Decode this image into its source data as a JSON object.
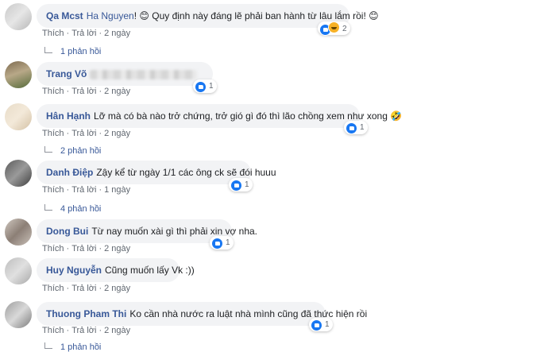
{
  "actions": {
    "like": "Thích",
    "reply": "Trả lời",
    "dot": "·"
  },
  "comments": [
    {
      "author": "Qa Mcst",
      "mention": "Ha Nguyen",
      "text": "! 😊 Quy định này đáng lẽ phải ban hành từ lâu lắm rồi! 😊",
      "time": "2 ngày",
      "reactions": {
        "types": [
          "like-icon",
          "haha-icon"
        ],
        "count": "2"
      },
      "replies": "1 phản hồi"
    },
    {
      "author": "Trang Võ",
      "text": "",
      "time": "2 ngày",
      "reactions": {
        "types": [
          "like-icon"
        ],
        "count": "1"
      },
      "replies": ""
    },
    {
      "author": "Hân Hạnh",
      "text": "Lỡ mà có bà nào trở chứng, trở gió gì đó thì lão chồng xem như xong 🤣",
      "time": "2 ngày",
      "reactions": {
        "types": [
          "like-icon"
        ],
        "count": "1"
      },
      "replies": "2 phản hồi"
    },
    {
      "author": "Danh Điệp",
      "text": "Zậy kể từ ngày 1/1 các ông ck sẽ đói huuu",
      "time": "1 ngày",
      "reactions": {
        "types": [
          "like-icon"
        ],
        "count": "1"
      },
      "replies": "4 phản hồi"
    },
    {
      "author": "Dong Bui",
      "text": "Từ nay muốn xài gì thì phải xin vợ nha.",
      "time": "2 ngày",
      "reactions": {
        "types": [
          "like-icon"
        ],
        "count": "1"
      },
      "replies": ""
    },
    {
      "author": "Huy Nguyễn",
      "text": "Cũng muốn lấy Vk :))",
      "time": "2 ngày",
      "reactions": null,
      "replies": ""
    },
    {
      "author": "Thuong Pham Thi",
      "text": "Ko cần nhà nước ra luật nhà mình cũng đã thức hiện rồi",
      "time": "2 ngày",
      "reactions": {
        "types": [
          "like-icon"
        ],
        "count": "1"
      },
      "replies": "1 phản hồi"
    }
  ]
}
